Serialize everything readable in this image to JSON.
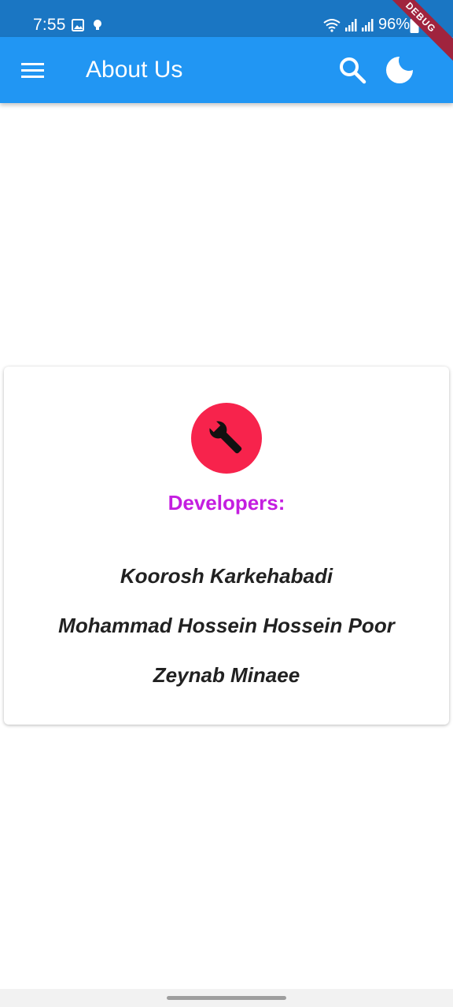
{
  "status_bar": {
    "time": "7:55",
    "battery": "96%",
    "background_color": "#1a76c3"
  },
  "debug_banner": "DEBUG",
  "app_bar": {
    "title": "About Us",
    "menu_icon": "menu-icon",
    "search_icon": "search-icon",
    "theme_icon": "moon-icon",
    "color": "#2196f3"
  },
  "card": {
    "icon": "wrench-icon",
    "icon_background": "#f7234c",
    "heading": "Developers:",
    "heading_color": "#c41ee0",
    "developers": [
      "Koorosh Karkehabadi",
      "Mohammad Hossein Hossein Poor",
      "Zeynab Minaee"
    ]
  }
}
